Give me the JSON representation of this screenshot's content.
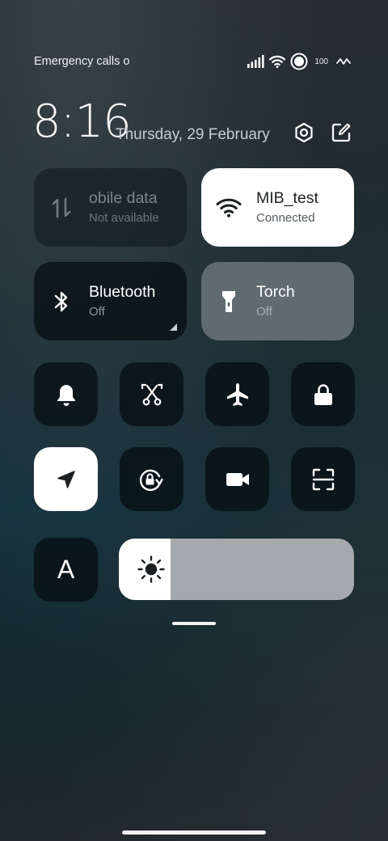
{
  "status_bar": {
    "carrier_text": "Emergency calls o",
    "battery": "100"
  },
  "header": {
    "time": "8:16",
    "date": "Thursday, 29 February"
  },
  "tiles": {
    "mobile_data": {
      "label": "obile data",
      "status": "Not available"
    },
    "wifi": {
      "label": "MIB_test",
      "status": "Connected"
    },
    "bluetooth": {
      "label": "Bluetooth",
      "status": "Off"
    },
    "torch": {
      "label": "Torch",
      "status": "Off"
    }
  },
  "font_size_label": "A",
  "brightness": {
    "level": 0.22
  },
  "colors": {
    "active_tile": "#ffffff",
    "inactive_tile": "#0a161b",
    "torch_tile": "#5f6b70",
    "slider_track": "#a3a9ac"
  }
}
